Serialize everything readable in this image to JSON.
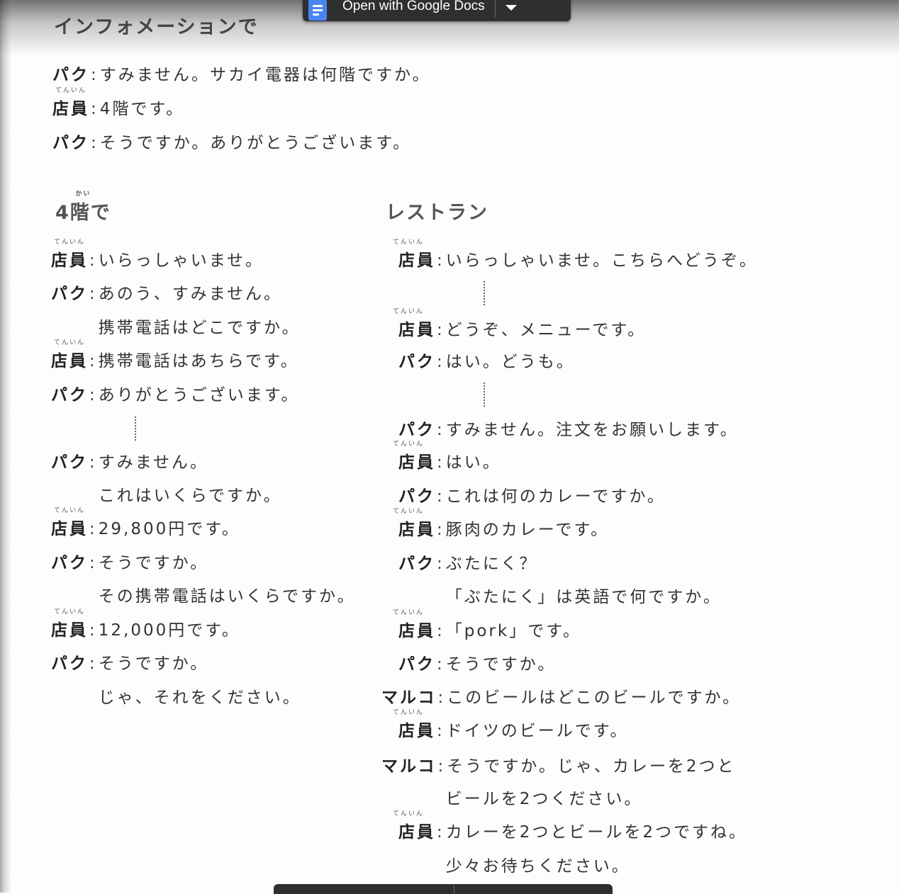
{
  "toolbar": {
    "open_with_label": "Open with Google Docs",
    "docs_icon": "google-docs-icon",
    "dropdown_icon": "caret-down-icon"
  },
  "sections": {
    "information": {
      "heading": "インフォメーションで",
      "lines": [
        {
          "speaker": "パク",
          "text": "すみません。サカイ電器は何階ですか。"
        },
        {
          "speaker": "店員",
          "speaker_ruby": "てんいん",
          "text": "4階です。"
        },
        {
          "speaker": "パク",
          "text": "そうですか。ありがとうございます。"
        }
      ]
    },
    "fourth_floor": {
      "heading": "4階で",
      "heading_ruby": "かい",
      "lines": [
        {
          "speaker": "店員",
          "speaker_ruby": "てんいん",
          "text": "いらっしゃいませ。"
        },
        {
          "speaker": "パク",
          "text": "あのう、すみません。"
        },
        {
          "speaker": "",
          "text": "携帯電話はどこですか。"
        },
        {
          "speaker": "店員",
          "speaker_ruby": "てんいん",
          "text": "携帯電話はあちらです。"
        },
        {
          "speaker": "パク",
          "text": "ありがとうございます。"
        },
        {
          "speaker": "パク",
          "text": "すみません。"
        },
        {
          "speaker": "",
          "text": "これはいくらですか。"
        },
        {
          "speaker": "店員",
          "speaker_ruby": "てんいん",
          "text": "29,800円です。"
        },
        {
          "speaker": "パク",
          "text": "そうですか。"
        },
        {
          "speaker": "",
          "text": "その携帯電話はいくらですか。"
        },
        {
          "speaker": "店員",
          "speaker_ruby": "てんいん",
          "text": "12,000円です。"
        },
        {
          "speaker": "パク",
          "text": "そうですか。"
        },
        {
          "speaker": "",
          "text": "じゃ、それをください。"
        }
      ]
    },
    "restaurant": {
      "heading": "レストラン",
      "lines": [
        {
          "speaker": "店員",
          "speaker_ruby": "てんいん",
          "text": "いらっしゃいませ。こちらへどうぞ。"
        },
        {
          "speaker": "店員",
          "speaker_ruby": "てんいん",
          "text": "どうぞ、メニューです。"
        },
        {
          "speaker": "パク",
          "text": "はい。どうも。"
        },
        {
          "speaker": "パク",
          "text": "すみません。注文をお願いします。"
        },
        {
          "speaker": "店員",
          "speaker_ruby": "てんいん",
          "text": "はい。"
        },
        {
          "speaker": "パク",
          "text": "これは何のカレーですか。"
        },
        {
          "speaker": "店員",
          "speaker_ruby": "てんいん",
          "text": "豚肉のカレーです。"
        },
        {
          "speaker": "パク",
          "text": "ぶたにく？"
        },
        {
          "speaker": "",
          "text": "「ぶたにく」は英語で何ですか。"
        },
        {
          "speaker": "店員",
          "speaker_ruby": "てんいん",
          "text": "「pork」です。"
        },
        {
          "speaker": "パク",
          "text": "そうですか。"
        },
        {
          "speaker": "マルコ",
          "text": "このビールはどこのビールですか。"
        },
        {
          "speaker": "店員",
          "speaker_ruby": "てんいん",
          "text": "ドイツのビールです。"
        },
        {
          "speaker": "マルコ",
          "text": "そうですか。じゃ、カレーを2つと"
        },
        {
          "speaker": "",
          "text": "ビールを2つください。"
        },
        {
          "speaker": "店員",
          "speaker_ruby": "てんいん",
          "text": "カレーを2つとビールを2つですね。"
        },
        {
          "speaker": "",
          "text": "少々お待ちください。"
        }
      ]
    }
  }
}
